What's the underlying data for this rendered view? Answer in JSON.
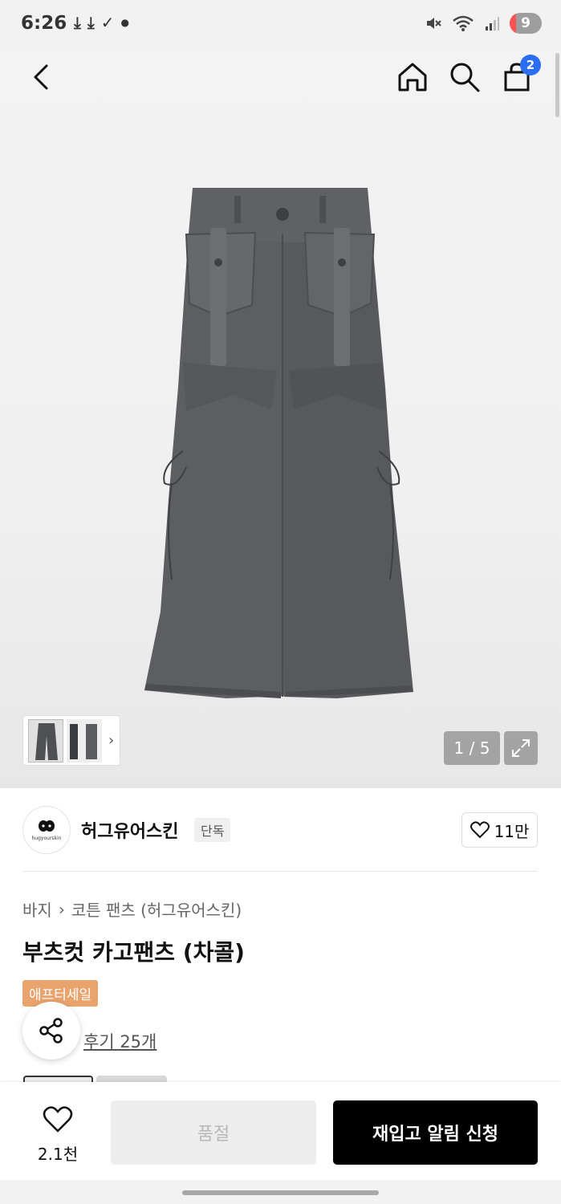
{
  "status_bar": {
    "time": "6:26",
    "left_icons": [
      "download-icon",
      "download-icon",
      "check-download-icon",
      "dot-icon"
    ],
    "battery_level": "9",
    "right_icons": [
      "mute-icon",
      "wifi-icon",
      "signal-icon",
      "battery-icon"
    ]
  },
  "top_nav": {
    "back_icon": "chevron-left-icon",
    "home_icon": "home-icon",
    "search_icon": "search-icon",
    "cart_icon": "shopping-bag-icon",
    "cart_count": "2"
  },
  "gallery": {
    "counter": "1 / 5",
    "thumbnail_arrow": "›",
    "expand_icon": "expand-icon"
  },
  "brand": {
    "name": "허그유어스킨",
    "tag": "단독",
    "likes": "11만",
    "logo_text": "hugyourskin"
  },
  "product": {
    "breadcrumb": [
      "바지",
      "코튼 팬츠 (허그유어스킨)"
    ],
    "breadcrumb_separator": "›",
    "title": "부츠컷 카고팬츠 (차콜)",
    "sale_badge": "애프터세일",
    "reviews": "후기 25개"
  },
  "bottom_bar": {
    "wish_count": "2.1천",
    "soldout_label": "품절",
    "restock_label": "재입고 알림 신청"
  },
  "colors": {
    "accent_blue": "#2c6ef2",
    "sale_orange": "#e9a36d",
    "primary_button": "#000000",
    "pants_gray": "#5c5e61"
  }
}
